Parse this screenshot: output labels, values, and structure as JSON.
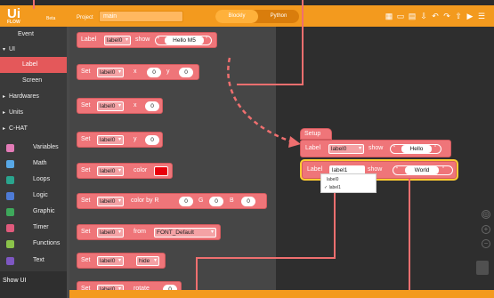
{
  "topbar": {
    "logo_big": "Ui",
    "logo_small": "FLOW",
    "version": "V1.3",
    "beta": "Beta",
    "project_label": "Project",
    "project_name": "main",
    "mode_blocks": "Blockly",
    "mode_python": "Python"
  },
  "sidebar": {
    "items": [
      {
        "label": "Event",
        "color": ""
      },
      {
        "label": "UI",
        "color": ""
      },
      {
        "label": "Label",
        "color": ""
      },
      {
        "label": "Screen",
        "color": ""
      },
      {
        "label": "Hardwares",
        "color": ""
      },
      {
        "label": "Units",
        "color": ""
      },
      {
        "label": "C-HAT",
        "color": ""
      },
      {
        "label": "Variables",
        "color": "#e37bb7"
      },
      {
        "label": "Math",
        "color": "#58a8e6"
      },
      {
        "label": "Loops",
        "color": "#2aa58e"
      },
      {
        "label": "Logic",
        "color": "#4e7bd6"
      },
      {
        "label": "Graphic",
        "color": "#3ea85b"
      },
      {
        "label": "Timer",
        "color": "#e05a7c"
      },
      {
        "label": "Functions",
        "color": "#8bc34a"
      },
      {
        "label": "Text",
        "color": "#7e57c2"
      }
    ],
    "show_ui": "Show UI"
  },
  "palette": {
    "b1": {
      "label": "Label",
      "var": "label0",
      "show": "show",
      "text": "Hello M5"
    },
    "b2": {
      "set": "Set",
      "var": "label0",
      "x": "x",
      "xv": "0",
      "y": "y",
      "yv": "0"
    },
    "b3": {
      "set": "Set",
      "var": "label0",
      "x": "x",
      "xv": "0"
    },
    "b4": {
      "set": "Set",
      "var": "label0",
      "y": "y",
      "yv": "0"
    },
    "b5": {
      "set": "Set",
      "var": "label0",
      "color": "color"
    },
    "b6": {
      "set": "Set",
      "var": "label0",
      "cbr": "color by R",
      "rv": "0",
      "g": "G",
      "gv": "0",
      "b": "B",
      "bv": "0"
    },
    "b7": {
      "set": "Set",
      "var": "label0",
      "from": "from",
      "font": "FONT_Default"
    },
    "b8": {
      "set": "Set",
      "var": "label0",
      "hide": "hide"
    },
    "b9": {
      "set": "Set",
      "var": "label0",
      "rotate": "rotate",
      "rv": "0"
    }
  },
  "workspace": {
    "setup": "Setup",
    "w1": {
      "label": "Label",
      "var": "label0",
      "show": "show",
      "text": "Hello"
    },
    "w2": {
      "label": "Label",
      "var": "label1",
      "show": "show",
      "text": "World"
    },
    "menu": [
      "label0",
      "✓ label1"
    ]
  },
  "colors": {
    "accent": "#f39a1e",
    "block": "#ef7579",
    "annotation": "#ef6f6f",
    "selected": "#e4585a"
  }
}
